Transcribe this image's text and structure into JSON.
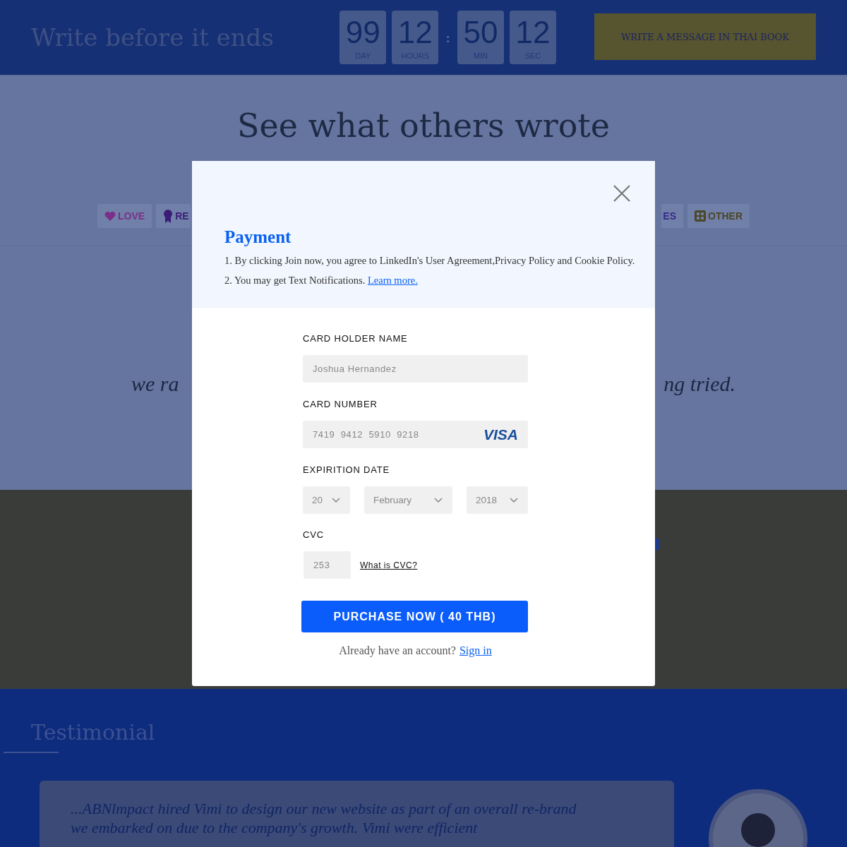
{
  "header": {
    "title": "Write before it ends",
    "countdown": [
      {
        "value": "99",
        "unit": "DAY"
      },
      {
        "value": "12",
        "unit": "HOURS"
      },
      {
        "value": "50",
        "unit": "MIN"
      },
      {
        "value": "12",
        "unit": "SEC"
      }
    ],
    "separator": ":",
    "cta": "WRITE A MESSAGE IN THAI BOOK"
  },
  "wall": {
    "heading": "See what others wrote",
    "categories": [
      {
        "label": "LOVE",
        "kind": "heart",
        "color": "#7a2f88"
      },
      {
        "label": "RE",
        "kind": "ribbon",
        "color": "#3b1d78"
      },
      {
        "label": "ES",
        "kind": "plain",
        "color": "#332a86"
      },
      {
        "label": "OTHER",
        "kind": "grid",
        "color": "#4b4727"
      }
    ],
    "quote_left": "we ra",
    "quote_right": "ng tried."
  },
  "testimonial": {
    "heading": "Testimonial",
    "quote": "...ABNlmpact hired Vimi to design our new website as part of an overall re-brand we embarked on due to the company's growth. Vimi were efficient"
  },
  "modal": {
    "title": "Payment",
    "terms": [
      {
        "text": "1. By clicking Join now, you agree to LinkedIn's User Agreement,Privacy Policy and Cookie Policy."
      },
      {
        "text": "2. You may get Text Notifications.",
        "link": "Learn more."
      }
    ],
    "holder_label": "CARD HOLDER NAME",
    "holder_value": "Joshua Hernandez",
    "number_label": "CARD NUMBER",
    "number_value": "7419  9412  5910  9218",
    "card_brand": "VISA",
    "expiry_label": "EXPIRITION DATE",
    "expiry": [
      {
        "value": "20"
      },
      {
        "value": "February"
      },
      {
        "value": "2018"
      }
    ],
    "cvc_label": "CVC",
    "cvc_value": "253",
    "cvc_help": "What is CVC?",
    "submit": "PURCHASE NOW ( 40 THB)",
    "signin_prompt": "Already have an account?",
    "signin_link": "Sign in"
  }
}
